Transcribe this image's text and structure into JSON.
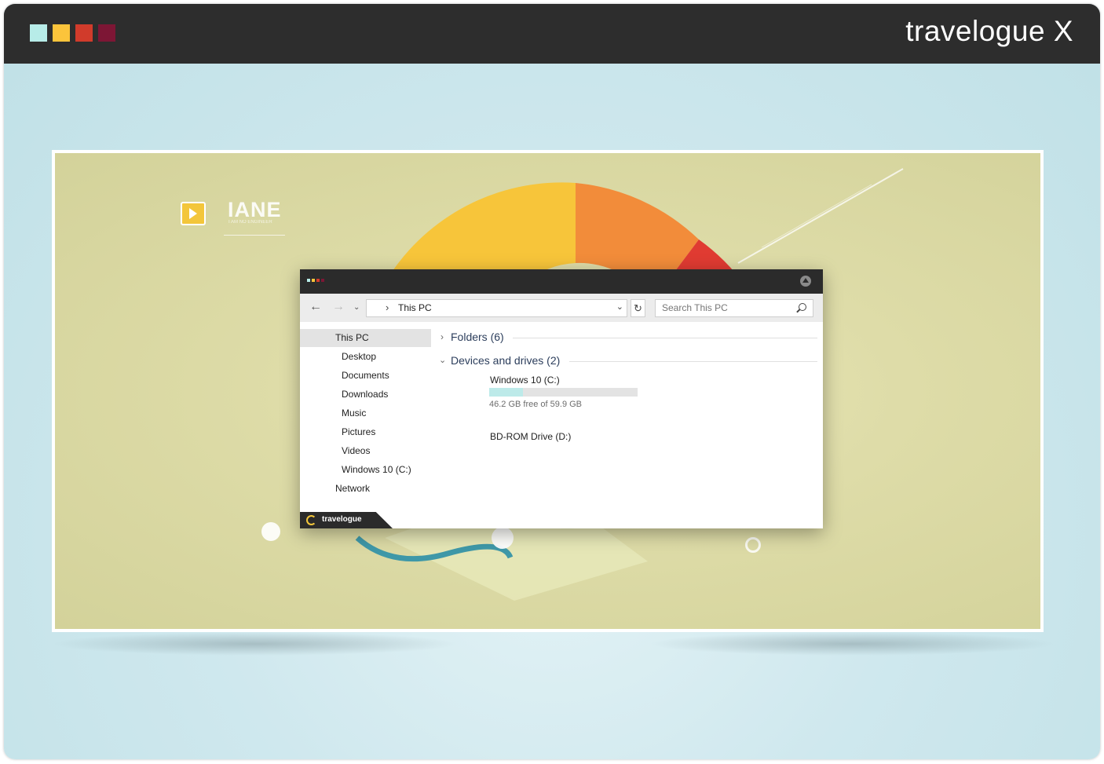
{
  "header": {
    "title": "travelogue X",
    "swatches": [
      "#b7ece8",
      "#fbc43b",
      "#d13b2b",
      "#7d1635"
    ]
  },
  "wallpaper": {
    "logo_text": "IANE",
    "logo_subtext": "I AM NO ENGINEER",
    "logo_icon": "play-folder-icon",
    "wedge_colors": [
      "#f7c53a",
      "#f28c3a",
      "#e03b32",
      "#4aa14b",
      "#5fb3c9"
    ]
  },
  "explorer": {
    "title_dots": [
      "#b7ece8",
      "#fbc43b",
      "#d13b2b",
      "#7d1635"
    ],
    "nav": {
      "back_icon": "arrow-left-icon",
      "forward_icon": "arrow-right-icon",
      "recent_icon": "chevron-down-icon",
      "address_chevron": "›",
      "address": "This PC",
      "refresh_icon": "refresh-icon",
      "search_placeholder": "Search This PC"
    },
    "sidebar": {
      "items": [
        {
          "label": "This PC",
          "selected": true,
          "level": 0
        },
        {
          "label": "Desktop",
          "level": 1
        },
        {
          "label": "Documents",
          "level": 1
        },
        {
          "label": "Downloads",
          "level": 1
        },
        {
          "label": "Music",
          "level": 1
        },
        {
          "label": "Pictures",
          "level": 1
        },
        {
          "label": "Videos",
          "level": 1
        },
        {
          "label": "Windows 10 (C:)",
          "level": 1
        },
        {
          "label": "Network",
          "level": 0
        }
      ]
    },
    "content": {
      "folders_group": "Folders (6)",
      "devices_group": "Devices and drives (2)",
      "drives": [
        {
          "name": "Windows 10 (C:)",
          "free_text": "46.2 GB free of 59.9 GB",
          "used_fraction": 0.23
        },
        {
          "name": "BD-ROM Drive (D:)"
        }
      ]
    },
    "footer": {
      "brand": "travelogue"
    }
  }
}
